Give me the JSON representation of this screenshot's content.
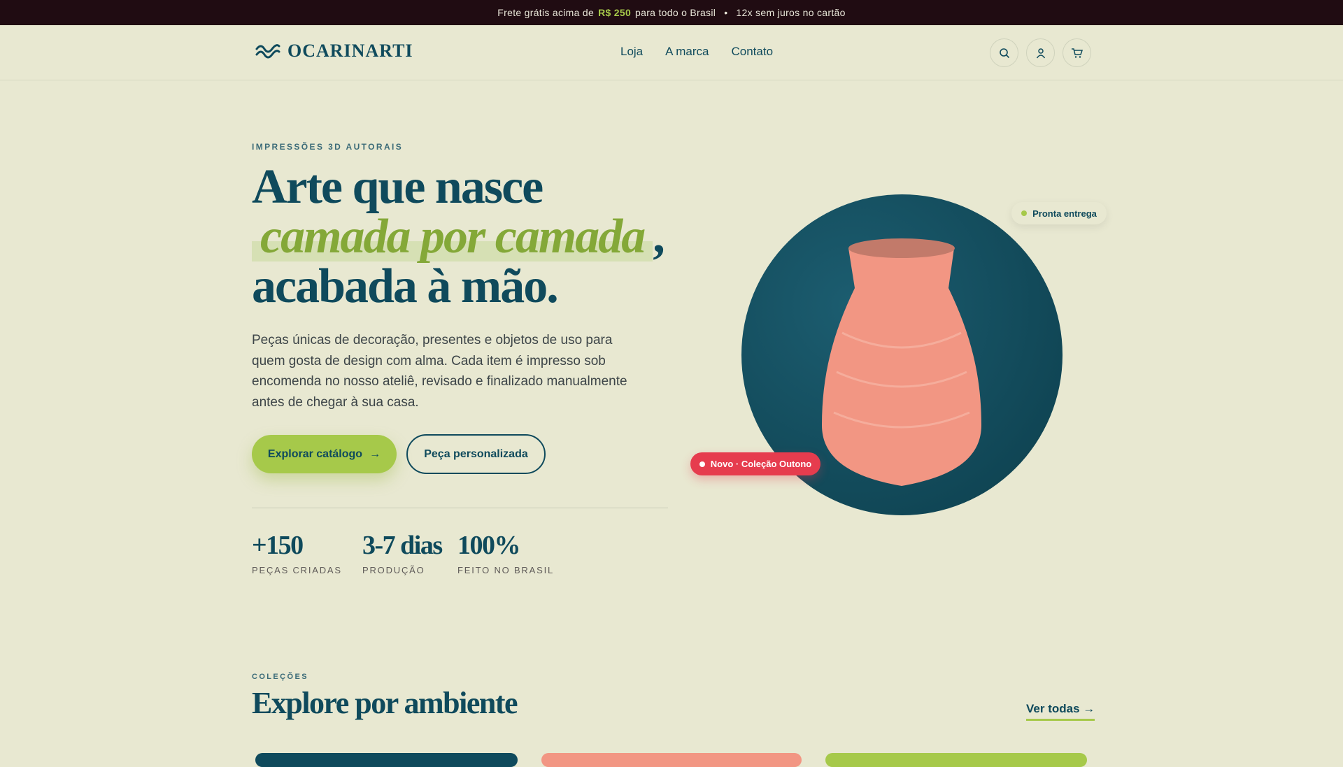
{
  "topbar": {
    "part1": "Frete grátis acima de",
    "highlight": "R$ 250",
    "part2": "para todo o Brasil",
    "separator": "•",
    "part3": "12x sem juros no cartão"
  },
  "nav": {
    "logo": "OCARINARTI",
    "links": [
      "Loja",
      "A marca",
      "Contato"
    ],
    "icons": [
      "search-icon",
      "user-icon",
      "cart-icon"
    ]
  },
  "hero": {
    "eyebrow": "IMPRESSÕES 3D AUTORAIS",
    "title_line1": "Arte que nasce",
    "title_highlight": "camada por camada",
    "title_comma": ",",
    "title_line3": "acabada à mão.",
    "paragraph": "Peças únicas de decoração, presentes e objetos de uso para quem gosta de design com alma. Cada item é impresso sob encomenda no nosso ateliê, revisado e finalizado manualmente antes de chegar à sua casa.",
    "primary_button": "Explorar catálogo",
    "primary_arrow": "→",
    "secondary_button": "Peça personalizada",
    "stats": [
      {
        "value": "+150",
        "label": "PEÇAS CRIADAS"
      },
      {
        "value": "3-7 dias",
        "label": "PRODUÇÃO"
      },
      {
        "value": "100%",
        "label": "FEITO NO BRASIL"
      }
    ],
    "pill": "Pronta entrega",
    "badge": "Novo · Coleção Outono"
  },
  "collections": {
    "eyebrow": "COLEÇÕES",
    "title": "Explore por ambiente",
    "link": "Ver todas →"
  },
  "colors": {
    "primary": "#0f4a5c",
    "accent": "#a6c94a",
    "badge": "#e63c4e",
    "vase": "#f29683",
    "topbar": "#200c12"
  }
}
